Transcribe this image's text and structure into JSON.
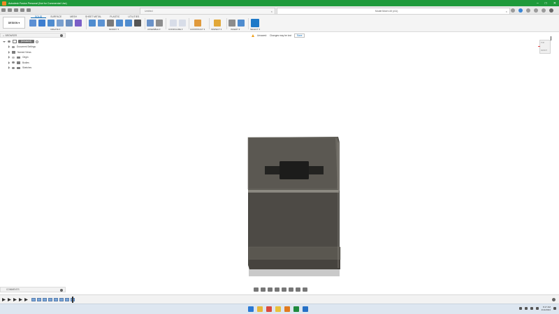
{
  "window": {
    "title": "Autodesk Fusion Personal (Not for Commercial Use)",
    "controls": [
      "–",
      "□",
      "✕"
    ]
  },
  "tabs": [
    {
      "label": "Untitled",
      "active": false
    },
    {
      "label": "Model Mold v15 (v11)",
      "active": true
    }
  ],
  "ribbon": {
    "workspace": "DESIGN ▾",
    "tabs": [
      "SOLID",
      "SURFACE",
      "MESH",
      "SHEET METAL",
      "PLASTIC",
      "UTILITIES"
    ],
    "active_tab": "SOLID",
    "groups": [
      "CREATE ▾",
      "MODIFY ▾",
      "ASSEMBLE ▾",
      "CONFIGURE ▾",
      "CONSTRUCT ▾",
      "INSPECT ▾",
      "INSERT ▾",
      "SELECT ▾"
    ]
  },
  "browser": {
    "title": "BROWSER",
    "root": "(Unsaved)",
    "items": [
      "Document Settings",
      "Named Views",
      "Origin",
      "Bodies",
      "Sketches"
    ]
  },
  "notice": {
    "label": "Unsaved:",
    "message": "Changes may be lost",
    "save": "Save"
  },
  "viewcube": {
    "top": "TOP",
    "front": "FRONT"
  },
  "comments": {
    "title": "COMMENTS"
  },
  "taskbar": {
    "time": "8:17 AM",
    "date": "4/14/2024"
  },
  "colors": {
    "title_bar": "#1f9a3b",
    "accent": "#0a6ab8",
    "model": "#55524c"
  }
}
